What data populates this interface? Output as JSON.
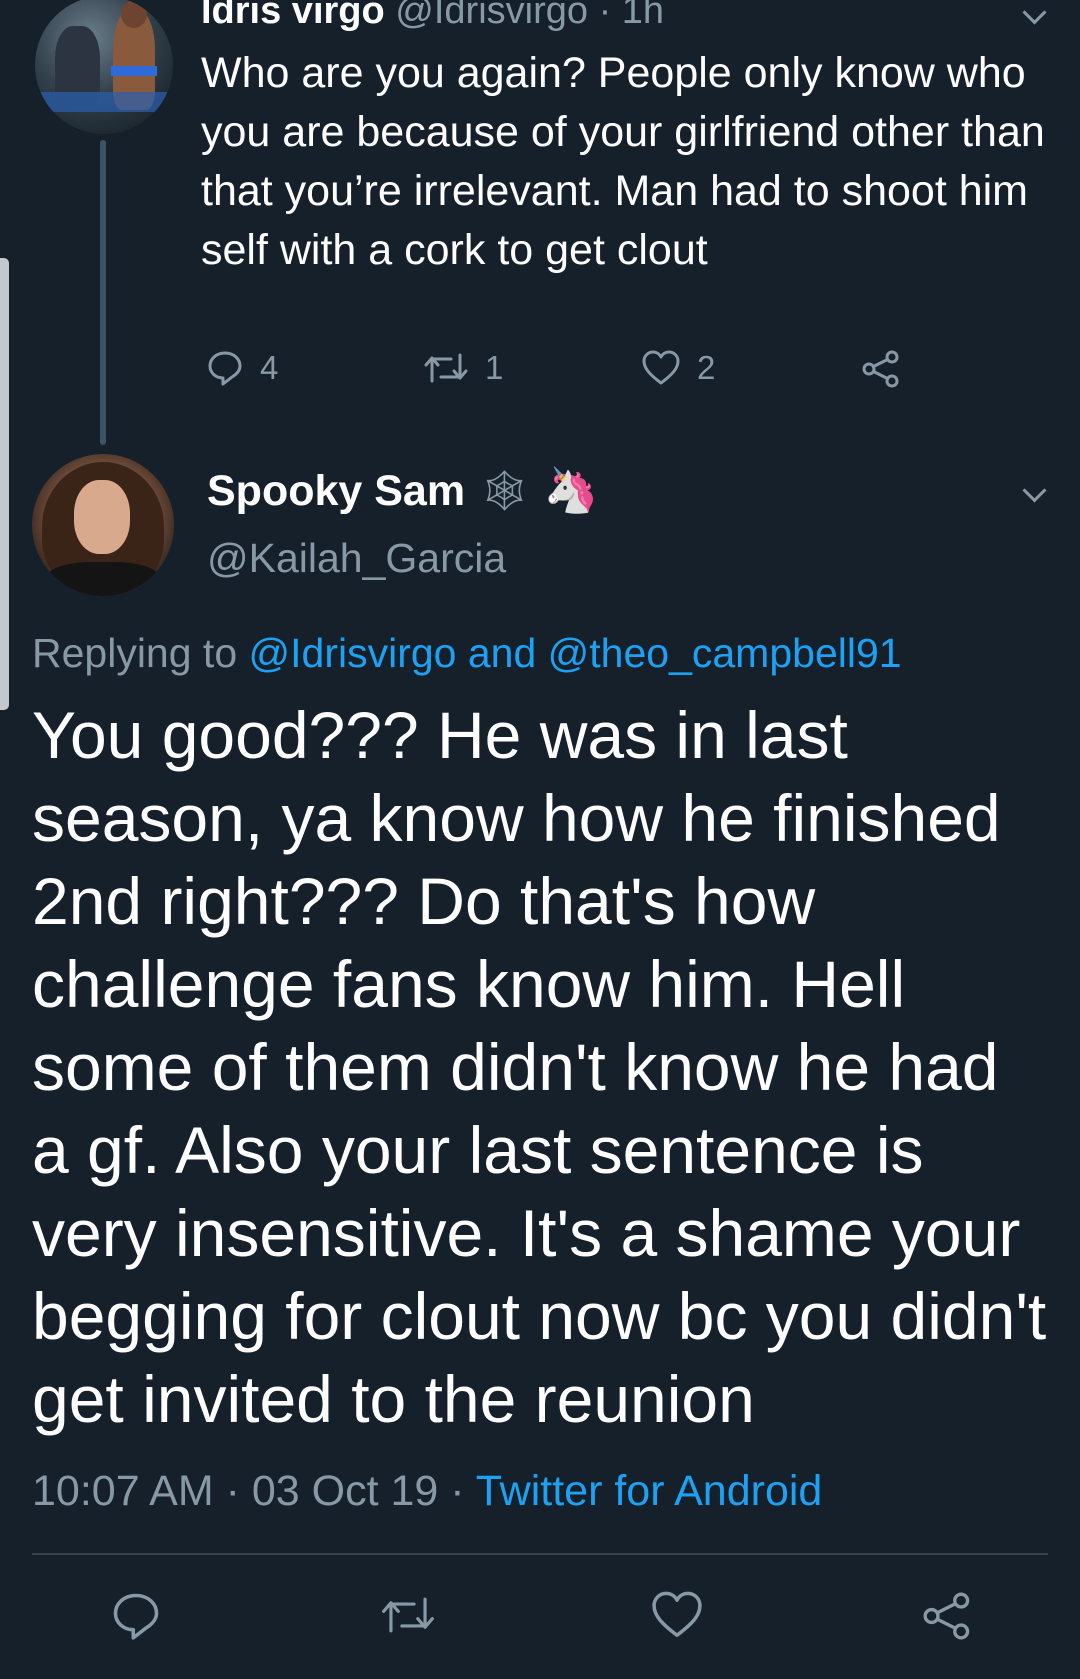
{
  "parent_tweet": {
    "name": "Idris virgo",
    "handle_time": "@Idrisvirgo · 1h",
    "text": "Who are you again? People only know who you are because of your girlfriend other than that you’re irrelevant. Man had to shoot him self with a cork to get clout",
    "reply_count": "4",
    "retweet_count": "1",
    "like_count": "2"
  },
  "main_tweet": {
    "name": "Spooky Sam",
    "name_emojis": [
      "🕸",
      "🦄"
    ],
    "handle": "@Kailah_Garcia",
    "replying_prefix": "Replying to",
    "replying_users": "@Idrisvirgo and @theo_campbell91",
    "text": "You good??? He was in last season, ya know how he finished 2nd right??? Do that's how challenge fans know him. Hell some of them didn't know he had a gf. Also your last sentence is very insensitive. It's a shame your begging for clout now bc you didn't get invited to the reunion",
    "timestamp": "10:07 AM · 03 Oct 19 ·",
    "source": "Twitter for Android"
  },
  "icons": [
    "reply-icon",
    "retweet-icon",
    "like-icon",
    "share-icon",
    "chevron-down-icon"
  ],
  "colors": {
    "background": "#15202b",
    "text_primary": "#ffffff",
    "text_secondary": "#8899a6",
    "link": "#1da1f2",
    "divider": "#38444d"
  }
}
